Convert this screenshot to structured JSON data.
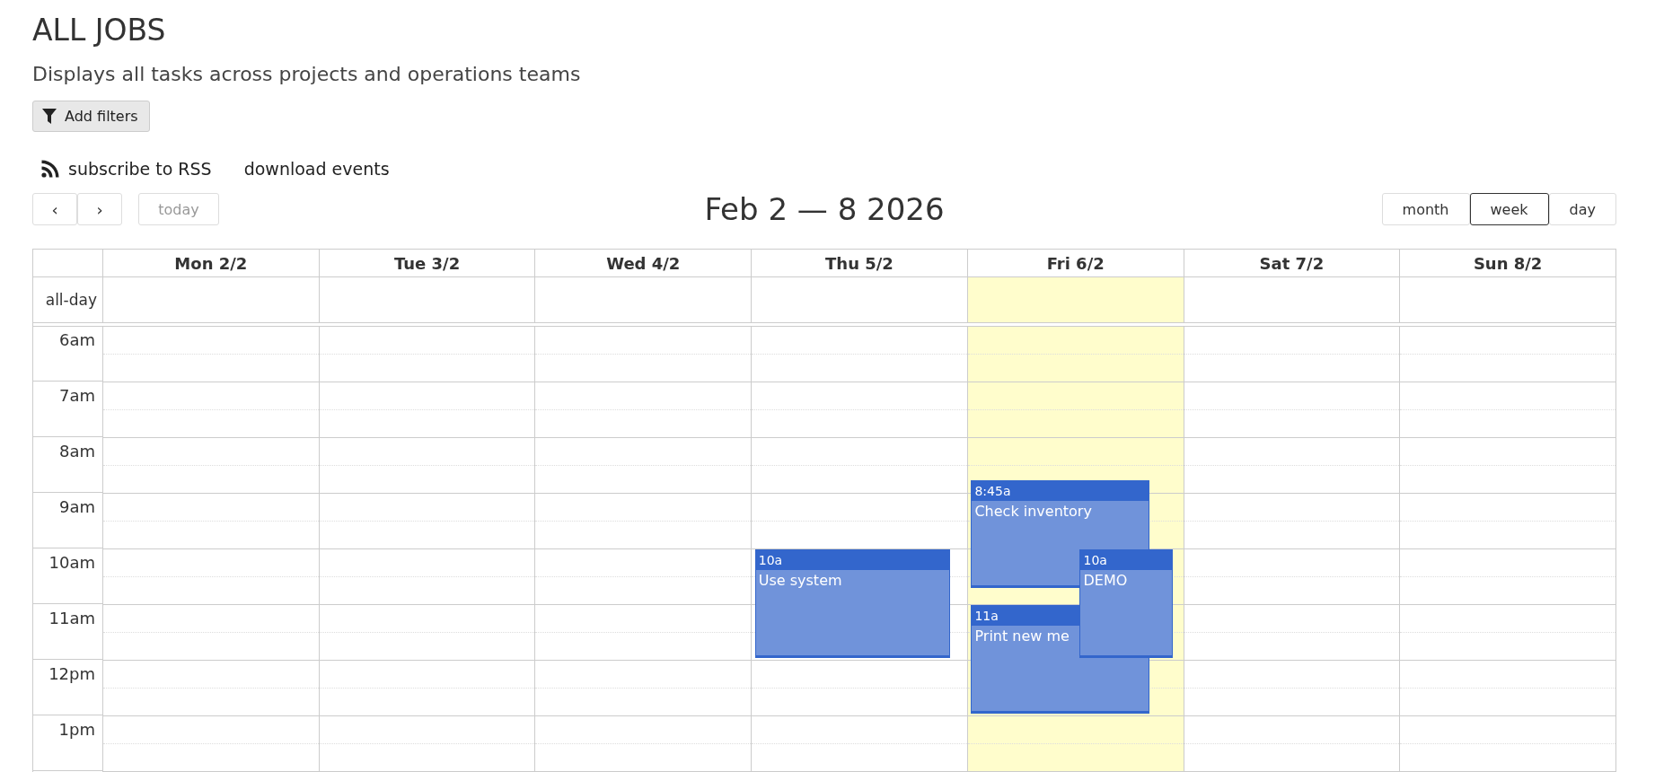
{
  "page": {
    "title": "ALL JOBS",
    "subtitle": "Displays all tasks across projects and operations teams"
  },
  "filter_button": {
    "label": "Add filters"
  },
  "links": [
    {
      "kind": "rss",
      "label": "subscribe to RSS"
    },
    {
      "kind": "plain",
      "label": "download events"
    }
  ],
  "toolbar": {
    "prev": "‹",
    "next": "›",
    "today": {
      "label": "today",
      "disabled": true
    },
    "title": "Feb 2 — 8 2026",
    "views": [
      {
        "label": "month",
        "selected": false
      },
      {
        "label": "week",
        "selected": true
      },
      {
        "label": "day",
        "selected": false
      }
    ]
  },
  "calendar": {
    "all_day_label": "all-day",
    "time_slots": [
      "6am",
      "7am",
      "8am",
      "9am",
      "10am",
      "11am",
      "12pm",
      "1pm"
    ],
    "days": [
      {
        "label": "Mon 2/2",
        "today": false
      },
      {
        "label": "Tue 3/2",
        "today": false
      },
      {
        "label": "Wed 4/2",
        "today": false
      },
      {
        "label": "Thu 5/2",
        "today": false,
        "events": [
          {
            "time": "10a",
            "title": "Use system"
          }
        ]
      },
      {
        "label": "Fri 6/2",
        "today": true,
        "events": [
          {
            "time": "8:45a",
            "title": "Check inventory"
          },
          {
            "time": "11a",
            "title": "Print new me"
          },
          {
            "time": "10a",
            "title": "DEMO"
          }
        ]
      },
      {
        "label": "Sat 7/2",
        "today": false
      },
      {
        "label": "Sun 8/2",
        "today": false
      }
    ]
  }
}
